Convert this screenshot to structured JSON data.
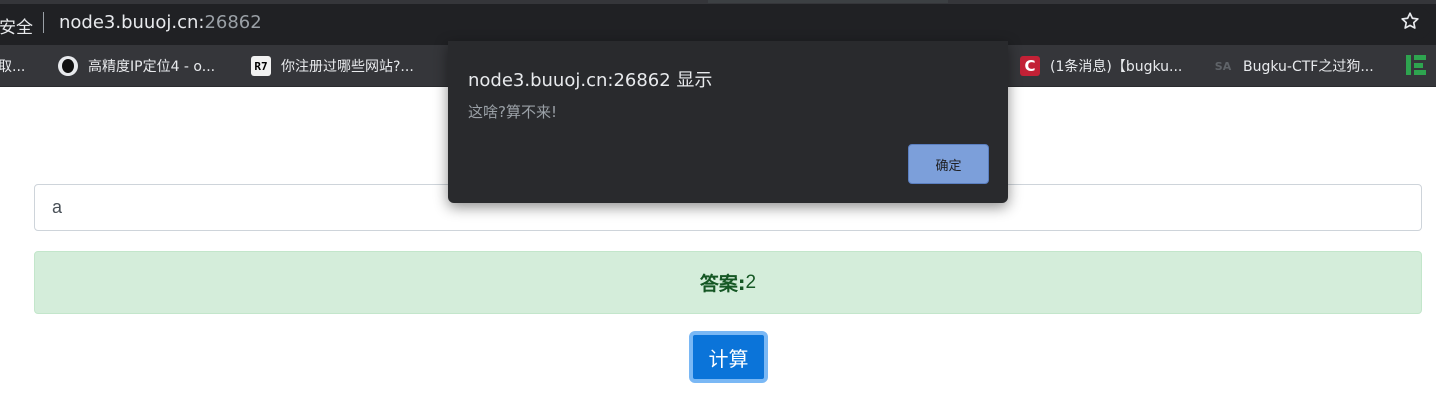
{
  "browser": {
    "security_label": "不安全",
    "url_host": "node3.buuoj.cn:",
    "url_port": "26862",
    "bookmarks": [
      {
        "label": "取...",
        "icon": "none"
      },
      {
        "label": "高精度IP定位4 - o...",
        "icon": "person-favicon"
      },
      {
        "label": "你注册过哪些网站?...",
        "icon": "r7-favicon",
        "glyph": "R7"
      },
      {
        "label": "(1条消息)【bugku...",
        "icon": "csdn-favicon",
        "glyph": "C"
      },
      {
        "label": "Bugku-CTF之过狗...",
        "icon": "sa-favicon",
        "glyph": "SA"
      }
    ]
  },
  "page": {
    "input_value": "a",
    "answer_label": "答案:",
    "answer_value": "2",
    "calc_button": "计算"
  },
  "alert": {
    "title": "node3.buuoj.cn:26862 显示",
    "message": "这啥?算不来!",
    "ok_button": "确定"
  },
  "colors": {
    "chrome_dark": "#202124",
    "bookmark_bar": "#35363a",
    "dialog_bg": "#292a2d",
    "dialog_button": "#7c9fda",
    "answer_bg": "#d4edda",
    "answer_text": "#155724",
    "primary_button": "#0b74d9"
  }
}
